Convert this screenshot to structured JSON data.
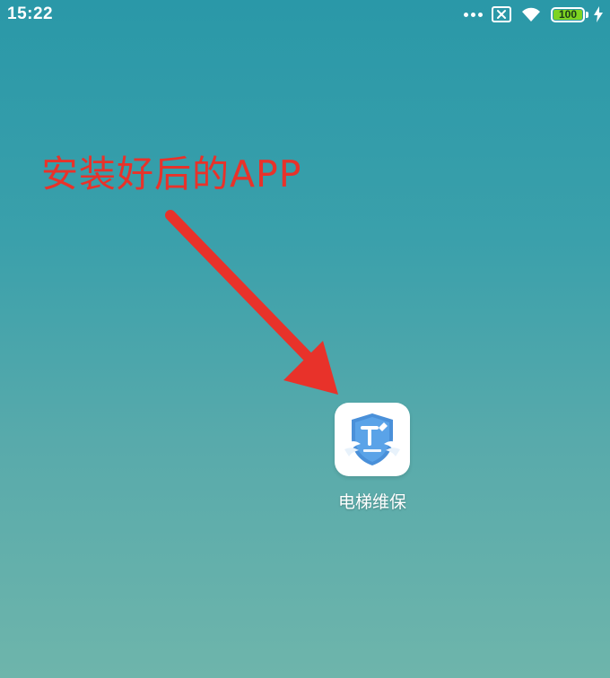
{
  "status_bar": {
    "time": "15:22",
    "icons": [
      "more-dots-icon",
      "no-sim-icon",
      "wifi-icon",
      "battery-icon",
      "charging-bolt-icon"
    ],
    "battery": {
      "level_text": "100",
      "level_fraction": 1.0,
      "color": "#7ed321"
    }
  },
  "annotation": {
    "text": "安装好后的APP",
    "color": "#e8322a"
  },
  "apps": [
    {
      "label": "电梯维保",
      "icon": "elevator-maintenance-shield-icon",
      "icon_colors": {
        "shield": "#4a90d9",
        "background": "#ffffff"
      }
    }
  ],
  "wallpaper": {
    "colors": [
      "#2a98a8",
      "#3aa0ab",
      "#58aaab",
      "#6eb5ab"
    ]
  }
}
